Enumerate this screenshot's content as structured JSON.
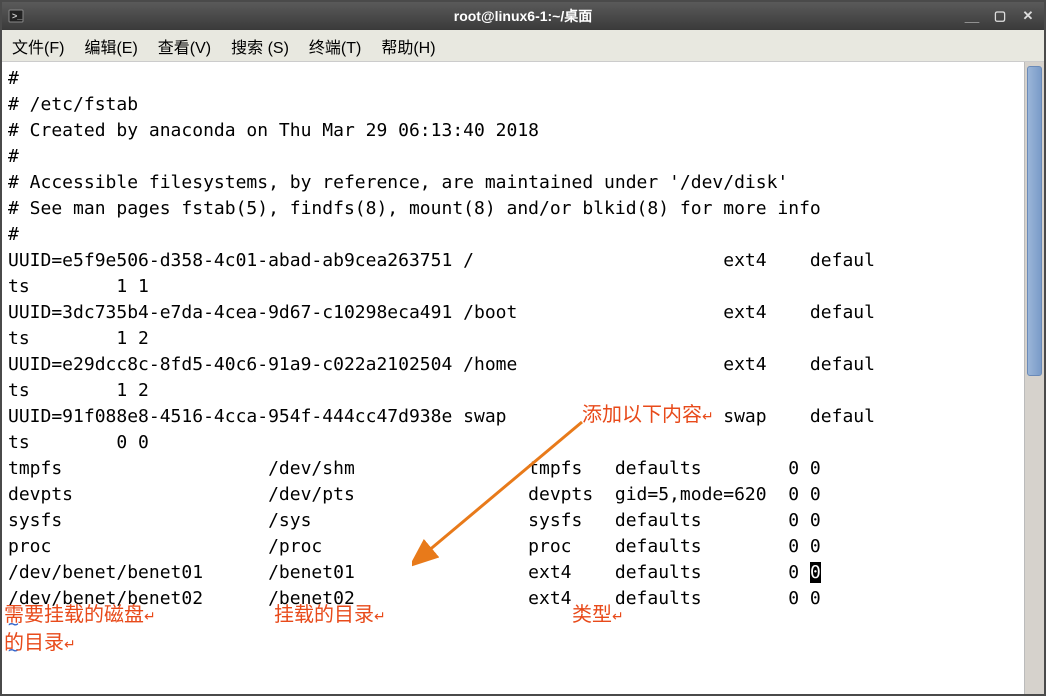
{
  "window": {
    "title": "root@linux6-1:~/桌面"
  },
  "menubar": {
    "items": [
      {
        "label": "文件(F)"
      },
      {
        "label": "编辑(E)"
      },
      {
        "label": "查看(V)"
      },
      {
        "label": "搜索 (S)"
      },
      {
        "label": "终端(T)"
      },
      {
        "label": "帮助(H)"
      }
    ]
  },
  "terminal": {
    "lines": [
      "#",
      "# /etc/fstab",
      "# Created by anaconda on Thu Mar 29 06:13:40 2018",
      "#",
      "# Accessible filesystems, by reference, are maintained under '/dev/disk'",
      "# See man pages fstab(5), findfs(8), mount(8) and/or blkid(8) for more info",
      "#",
      "UUID=e5f9e506-d358-4c01-abad-ab9cea263751 /                       ext4    defaul",
      "ts        1 1",
      "UUID=3dc735b4-e7da-4cea-9d67-c10298eca491 /boot                   ext4    defaul",
      "ts        1 2",
      "UUID=e29dcc8c-8fd5-40c6-91a9-c022a2102504 /home                   ext4    defaul",
      "ts        1 2",
      "UUID=91f088e8-4516-4cca-954f-444cc47d938e swap                    swap    defaul",
      "ts        0 0",
      "tmpfs                   /dev/shm                tmpfs   defaults        0 0",
      "devpts                  /dev/pts                devpts  gid=5,mode=620  0 0",
      "sysfs                   /sys                    sysfs   defaults        0 0",
      "proc                    /proc                   proc    defaults        0 0",
      "/dev/benet/benet01      /benet01                ext4    defaults        0 ",
      "/dev/benet/benet02      /benet02                ext4    defaults        0 0"
    ],
    "cursor_char": "0",
    "tilde_lines": [
      "~",
      "~"
    ]
  },
  "annotations": {
    "add_content": "添加以下内容",
    "disk_dir_1": "需要挂载的磁盘",
    "disk_dir_2": "的目录",
    "mount_dir": "挂载的目录",
    "type": "类型",
    "marker": "↵"
  }
}
